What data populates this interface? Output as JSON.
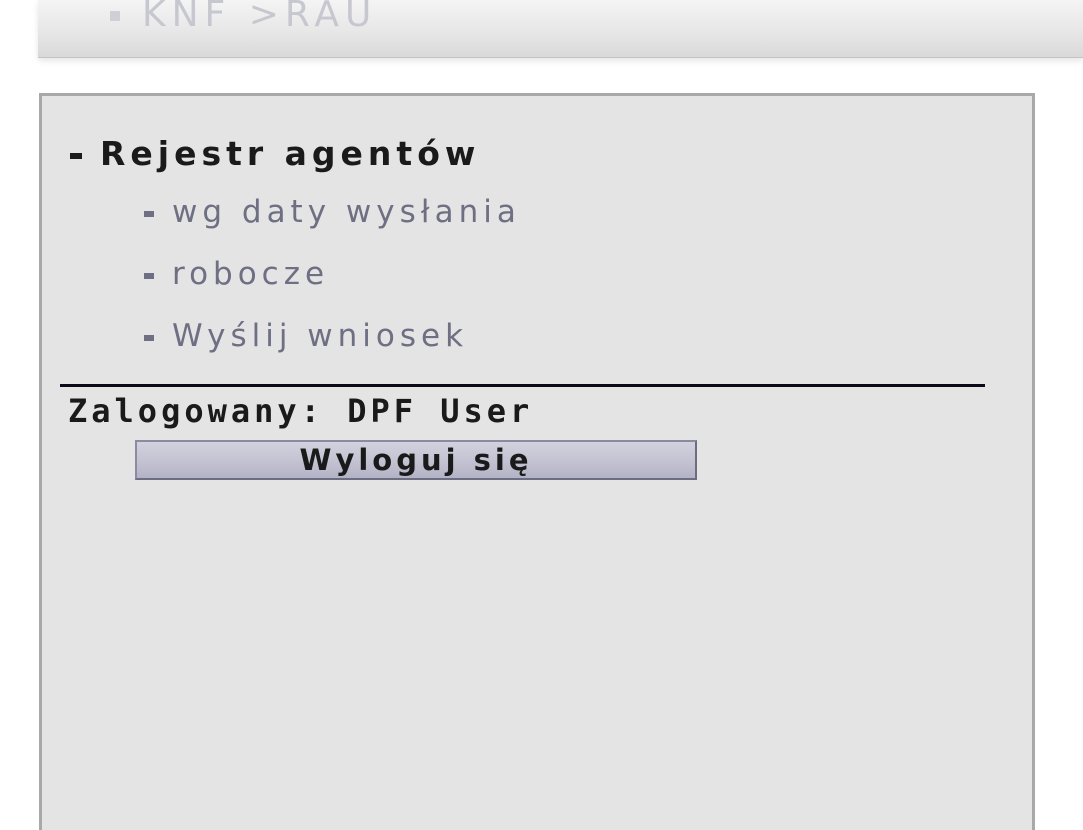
{
  "header": {
    "breadcrumb_label": "KNF >RAU"
  },
  "menu": {
    "main_item": "Rejestr agentów",
    "sub_items": [
      "wg daty wysłania",
      "robocze",
      "Wyślij wniosek"
    ]
  },
  "session": {
    "logged_in_label": "Zalogowany: DPF User",
    "logout_label": "Wyloguj się"
  },
  "colors": {
    "panel_background": "#e4e4e4",
    "panel_border": "#a8a8a8",
    "main_item_text": "#1a1a1a",
    "sub_item_text": "#6f6f84",
    "header_link_text": "#c7c7cf",
    "divider": "#0a0a1a",
    "button_background": "#c2c2d2"
  }
}
